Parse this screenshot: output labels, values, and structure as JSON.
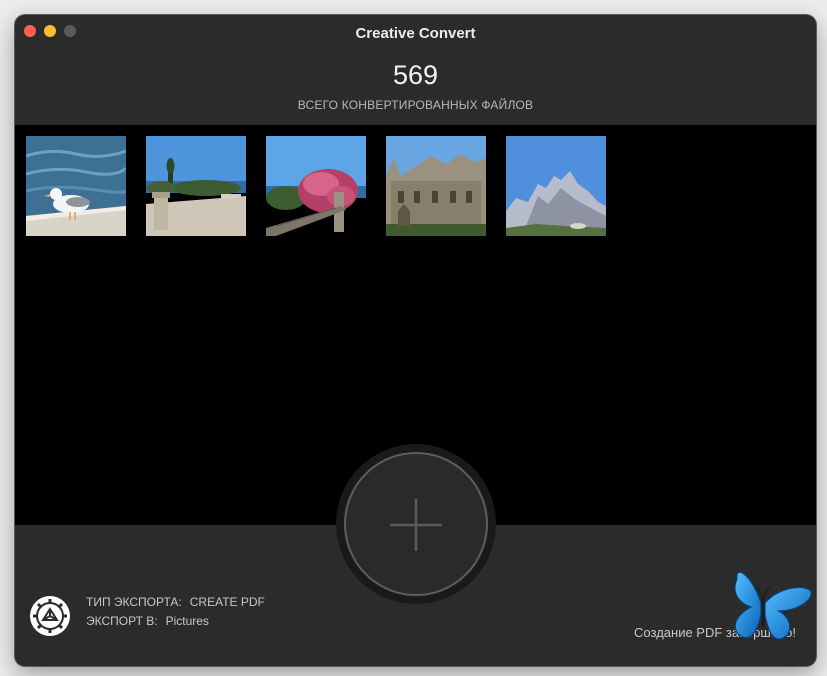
{
  "window": {
    "title": "Creative Convert"
  },
  "stats": {
    "count": "569",
    "label": "ВСЕГО КОНВЕРТИРОВАННЫХ ФАЙЛОВ"
  },
  "gallery": {
    "thumbnails": [
      "seagull-photo",
      "terrace-sea-photo",
      "oleander-photo",
      "palace-photo",
      "mountain-photo"
    ]
  },
  "footer": {
    "export_type_label": "ТИП ЭКСПОРТА:",
    "export_type_value": "CREATE PDF",
    "export_to_label": "ЭКСПОРТ В:",
    "export_to_value": "Pictures",
    "status": "Создание PDF завершено!"
  },
  "colors": {
    "close": "#fe5f57",
    "minimize": "#febc2e",
    "zoom_inactive": "#5a5a5a",
    "butterfly": "#1e90e8"
  }
}
